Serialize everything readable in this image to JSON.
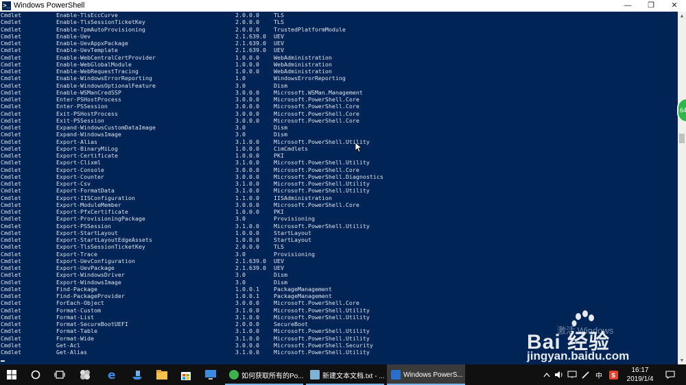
{
  "window": {
    "title": "Windows PowerShell",
    "minimize": "—",
    "maximize": "❐",
    "close": "✕"
  },
  "console": {
    "rows": [
      {
        "type": "Cmdlet",
        "name": "Enable-TlsEccCurve",
        "version": "2.0.0.0",
        "source": "TLS"
      },
      {
        "type": "Cmdlet",
        "name": "Enable-TlsSessionTicketKey",
        "version": "2.0.0.0",
        "source": "TLS"
      },
      {
        "type": "Cmdlet",
        "name": "Enable-TpmAutoProvisioning",
        "version": "2.0.0.0",
        "source": "TrustedPlatformModule"
      },
      {
        "type": "Cmdlet",
        "name": "Enable-Uev",
        "version": "2.1.639.0",
        "source": "UEV"
      },
      {
        "type": "Cmdlet",
        "name": "Enable-UevAppxPackage",
        "version": "2.1.639.0",
        "source": "UEV"
      },
      {
        "type": "Cmdlet",
        "name": "Enable-UevTemplate",
        "version": "2.1.639.0",
        "source": "UEV"
      },
      {
        "type": "Cmdlet",
        "name": "Enable-WebCentralCertProvider",
        "version": "1.0.0.0",
        "source": "WebAdministration"
      },
      {
        "type": "Cmdlet",
        "name": "Enable-WebGlobalModule",
        "version": "1.0.0.0",
        "source": "WebAdministration"
      },
      {
        "type": "Cmdlet",
        "name": "Enable-WebRequestTracing",
        "version": "1.0.0.0",
        "source": "WebAdministration"
      },
      {
        "type": "Cmdlet",
        "name": "Enable-WindowsErrorReporting",
        "version": "1.0",
        "source": "WindowsErrorReporting"
      },
      {
        "type": "Cmdlet",
        "name": "Enable-WindowsOptionalFeature",
        "version": "3.0",
        "source": "Dism"
      },
      {
        "type": "Cmdlet",
        "name": "Enable-WSManCredSSP",
        "version": "3.0.0.0",
        "source": "Microsoft.WSMan.Management"
      },
      {
        "type": "Cmdlet",
        "name": "Enter-PSHostProcess",
        "version": "3.0.0.0",
        "source": "Microsoft.PowerShell.Core"
      },
      {
        "type": "Cmdlet",
        "name": "Enter-PSSession",
        "version": "3.0.0.0",
        "source": "Microsoft.PowerShell.Core"
      },
      {
        "type": "Cmdlet",
        "name": "Exit-PSHostProcess",
        "version": "3.0.0.0",
        "source": "Microsoft.PowerShell.Core"
      },
      {
        "type": "Cmdlet",
        "name": "Exit-PSSession",
        "version": "3.0.0.0",
        "source": "Microsoft.PowerShell.Core"
      },
      {
        "type": "Cmdlet",
        "name": "Expand-WindowsCustomDataImage",
        "version": "3.0",
        "source": "Dism"
      },
      {
        "type": "Cmdlet",
        "name": "Expand-WindowsImage",
        "version": "3.0",
        "source": "Dism"
      },
      {
        "type": "Cmdlet",
        "name": "Export-Alias",
        "version": "3.1.0.0",
        "source": "Microsoft.PowerShell.Utility"
      },
      {
        "type": "Cmdlet",
        "name": "Export-BinaryMiLog",
        "version": "1.0.0.0",
        "source": "CimCmdlets"
      },
      {
        "type": "Cmdlet",
        "name": "Export-Certificate",
        "version": "1.0.0.0",
        "source": "PKI"
      },
      {
        "type": "Cmdlet",
        "name": "Export-Clixml",
        "version": "3.1.0.0",
        "source": "Microsoft.PowerShell.Utility"
      },
      {
        "type": "Cmdlet",
        "name": "Export-Console",
        "version": "3.0.0.0",
        "source": "Microsoft.PowerShell.Core"
      },
      {
        "type": "Cmdlet",
        "name": "Export-Counter",
        "version": "3.0.0.0",
        "source": "Microsoft.PowerShell.Diagnostics"
      },
      {
        "type": "Cmdlet",
        "name": "Export-Csv",
        "version": "3.1.0.0",
        "source": "Microsoft.PowerShell.Utility"
      },
      {
        "type": "Cmdlet",
        "name": "Export-FormatData",
        "version": "3.1.0.0",
        "source": "Microsoft.PowerShell.Utility"
      },
      {
        "type": "Cmdlet",
        "name": "Export-IISConfiguration",
        "version": "1.1.0.0",
        "source": "IISAdministration"
      },
      {
        "type": "Cmdlet",
        "name": "Export-ModuleMember",
        "version": "3.0.0.0",
        "source": "Microsoft.PowerShell.Core"
      },
      {
        "type": "Cmdlet",
        "name": "Export-PfxCertificate",
        "version": "1.0.0.0",
        "source": "PKI"
      },
      {
        "type": "Cmdlet",
        "name": "Export-ProvisioningPackage",
        "version": "3.0",
        "source": "Provisioning"
      },
      {
        "type": "Cmdlet",
        "name": "Export-PSSession",
        "version": "3.1.0.0",
        "source": "Microsoft.PowerShell.Utility"
      },
      {
        "type": "Cmdlet",
        "name": "Export-StartLayout",
        "version": "1.0.0.0",
        "source": "StartLayout"
      },
      {
        "type": "Cmdlet",
        "name": "Export-StartLayoutEdgeAssets",
        "version": "1.0.0.0",
        "source": "StartLayout"
      },
      {
        "type": "Cmdlet",
        "name": "Export-TlsSessionTicketKey",
        "version": "2.0.0.0",
        "source": "TLS"
      },
      {
        "type": "Cmdlet",
        "name": "Export-Trace",
        "version": "3.0",
        "source": "Provisioning"
      },
      {
        "type": "Cmdlet",
        "name": "Export-UevConfiguration",
        "version": "2.1.639.0",
        "source": "UEV"
      },
      {
        "type": "Cmdlet",
        "name": "Export-UevPackage",
        "version": "2.1.639.0",
        "source": "UEV"
      },
      {
        "type": "Cmdlet",
        "name": "Export-WindowsDriver",
        "version": "3.0",
        "source": "Dism"
      },
      {
        "type": "Cmdlet",
        "name": "Export-WindowsImage",
        "version": "3.0",
        "source": "Dism"
      },
      {
        "type": "Cmdlet",
        "name": "Find-Package",
        "version": "1.0.0.1",
        "source": "PackageManagement"
      },
      {
        "type": "Cmdlet",
        "name": "Find-PackageProvider",
        "version": "1.0.0.1",
        "source": "PackageManagement"
      },
      {
        "type": "Cmdlet",
        "name": "ForEach-Object",
        "version": "3.0.0.0",
        "source": "Microsoft.PowerShell.Core"
      },
      {
        "type": "Cmdlet",
        "name": "Format-Custom",
        "version": "3.1.0.0",
        "source": "Microsoft.PowerShell.Utility"
      },
      {
        "type": "Cmdlet",
        "name": "Format-List",
        "version": "3.1.0.0",
        "source": "Microsoft.PowerShell.Utility"
      },
      {
        "type": "Cmdlet",
        "name": "Format-SecureBootUEFI",
        "version": "2.0.0.0",
        "source": "SecureBoot"
      },
      {
        "type": "Cmdlet",
        "name": "Format-Table",
        "version": "3.1.0.0",
        "source": "Microsoft.PowerShell.Utility"
      },
      {
        "type": "Cmdlet",
        "name": "Format-Wide",
        "version": "3.1.0.0",
        "source": "Microsoft.PowerShell.Utility"
      },
      {
        "type": "Cmdlet",
        "name": "Get-Acl",
        "version": "3.0.0.0",
        "source": "Microsoft.PowerShell.Security"
      },
      {
        "type": "Cmdlet",
        "name": "Get-Alias",
        "version": "3.1.0.0",
        "source": "Microsoft.PowerShell.Utility"
      }
    ]
  },
  "badge": {
    "text": "64"
  },
  "watermark": {
    "activate": "激活 Windows",
    "brand": "Bai 经验",
    "url": "jingyan.baidu.com"
  },
  "taskbar": {
    "apps": [
      {
        "label": "如何获取所有的Po...",
        "icon": "browser-icon",
        "color": "#3bb34a"
      },
      {
        "label": "新建文本文档.txt - ...",
        "icon": "notepad-icon",
        "color": "#7fb2d6"
      },
      {
        "label": "Windows PowerS...",
        "icon": "powershell-icon",
        "color": "#2a6fc9"
      }
    ],
    "tray": {
      "lang": "中",
      "time": "16:17",
      "date": "2019/1/4"
    }
  }
}
